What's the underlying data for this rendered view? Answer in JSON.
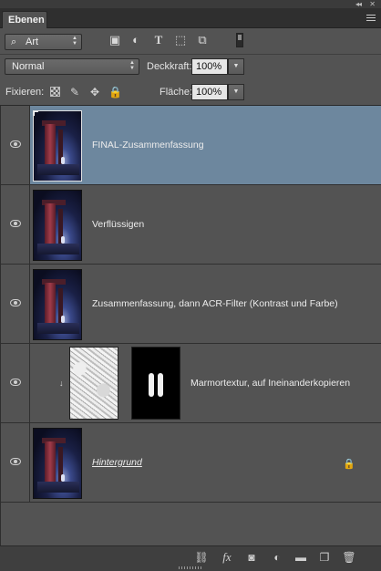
{
  "panel": {
    "tab_label": "Ebenen",
    "collapse_glyph": "◂◂",
    "close_glyph": "✕"
  },
  "filter": {
    "kind_label": "Art",
    "kind_icon": "search-icon",
    "filter_icons": [
      "image-filter-icon",
      "adjustment-filter-icon",
      "type-filter-icon",
      "shape-filter-icon",
      "smart-object-filter-icon"
    ]
  },
  "blend": {
    "mode_label": "Normal",
    "opacity_label": "Deckkraft:",
    "opacity_value": "100%"
  },
  "lock": {
    "label": "Fixieren:",
    "fill_label": "Fläche:",
    "fill_value": "100%"
  },
  "layers": [
    {
      "name": "FINAL-Zusammenfassung",
      "selected": true
    },
    {
      "name": "Verflüssigen",
      "selected": false
    },
    {
      "name": "Zusammenfassung, dann ACR-Filter (Kontrast und Farbe)",
      "selected": false
    },
    {
      "name": "Marmortextur, auf Ineinanderkopieren",
      "selected": false,
      "clipped": true
    },
    {
      "name": "Hintergrund",
      "selected": false,
      "locked": true
    }
  ],
  "footer": {
    "icons": [
      "link-icon",
      "fx-icon",
      "mask-icon",
      "adjustment-layer-icon",
      "group-folder-icon",
      "new-layer-icon",
      "trash-icon"
    ],
    "fx_label": "fx"
  },
  "colors": {
    "panel_bg": "#535353",
    "selected_row": "#6d879e"
  }
}
